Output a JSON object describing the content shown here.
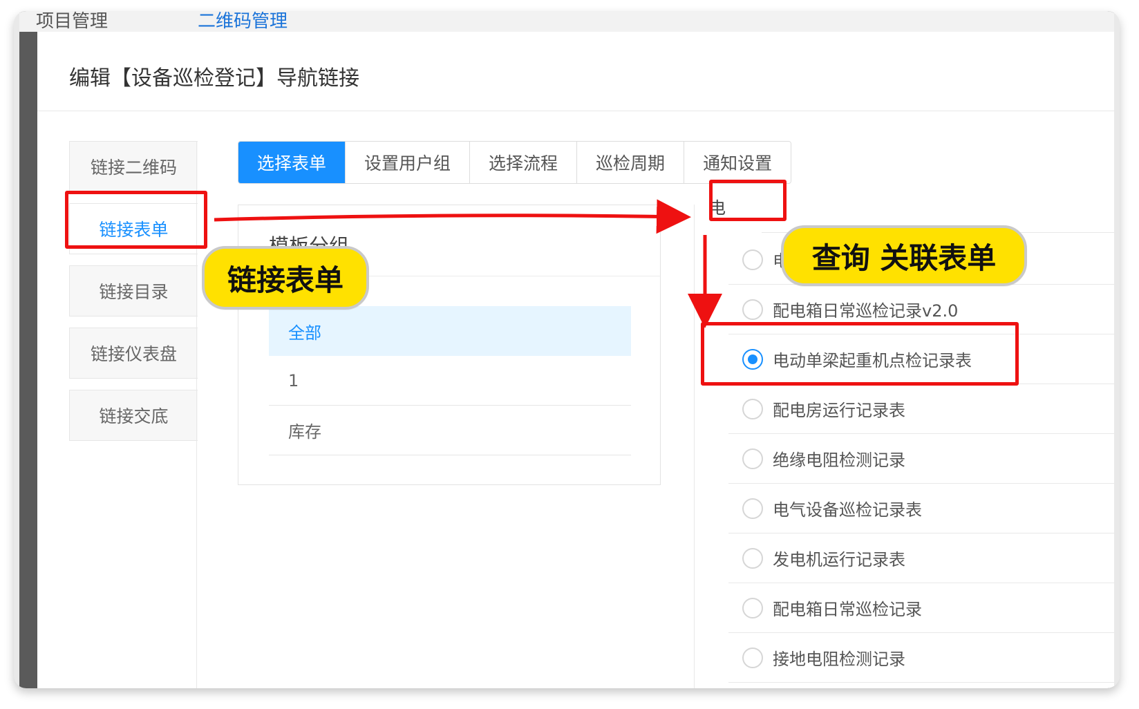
{
  "background": {
    "crumb_left": "项目管理",
    "crumb_right": "二维码管理"
  },
  "modal": {
    "title": "编辑【设备巡检登记】导航链接"
  },
  "side_menu": [
    {
      "label": "链接二维码",
      "active": false
    },
    {
      "label": "链接表单",
      "active": true
    },
    {
      "label": "链接目录",
      "active": false
    },
    {
      "label": "链接仪表盘",
      "active": false
    },
    {
      "label": "链接交底",
      "active": false
    }
  ],
  "tabs": [
    {
      "label": "选择表单",
      "active": true
    },
    {
      "label": "设置用户组",
      "active": false
    },
    {
      "label": "选择流程",
      "active": false
    },
    {
      "label": "巡检周期",
      "active": false
    },
    {
      "label": "通知设置",
      "active": false
    }
  ],
  "template_group": {
    "title": "模板分组",
    "items": [
      {
        "label": "全部",
        "active": true
      },
      {
        "label": "1",
        "active": false
      },
      {
        "label": "库存",
        "active": false
      }
    ]
  },
  "search": {
    "value": "电"
  },
  "forms": [
    {
      "label": "电动",
      "checked": false
    },
    {
      "label": "配电箱日常巡检记录v2.0",
      "checked": false
    },
    {
      "label": "电动单梁起重机点检记录表",
      "checked": true
    },
    {
      "label": "配电房运行记录表",
      "checked": false
    },
    {
      "label": "绝缘电阻检测记录",
      "checked": false
    },
    {
      "label": "电气设备巡检记录表",
      "checked": false
    },
    {
      "label": "发电机运行记录表",
      "checked": false
    },
    {
      "label": "配电箱日常巡检记录",
      "checked": false
    },
    {
      "label": "接地电阻检测记录",
      "checked": false
    }
  ],
  "annotations": {
    "callout_link_form": "链接表单",
    "callout_query": "查询 关联表单",
    "highlight_color": "#ee1111",
    "callout_color": "#ffe100",
    "accent_color": "#1890ff"
  }
}
